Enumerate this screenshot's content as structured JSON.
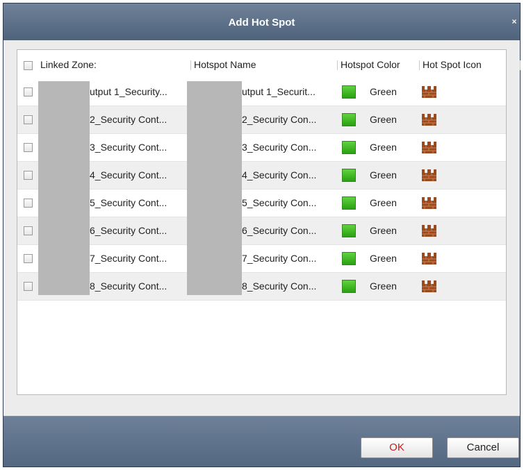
{
  "dialog": {
    "title": "Add Hot Spot",
    "close_glyph": "×"
  },
  "table": {
    "columns": {
      "linked_zone": "Linked Zone:",
      "hotspot_name": "Hotspot Name",
      "hotspot_color": "Hotspot Color",
      "hotspot_icon": "Hot Spot Icon"
    },
    "rows": [
      {
        "linked_zone": "utput 1_Security...",
        "hotspot_name": "utput 1_Securit...",
        "color": "Green",
        "icon": "castle-wall-icon"
      },
      {
        "linked_zone": "2_Security Cont...",
        "hotspot_name": "2_Security Con...",
        "color": "Green",
        "icon": "castle-wall-icon"
      },
      {
        "linked_zone": "3_Security Cont...",
        "hotspot_name": "3_Security Con...",
        "color": "Green",
        "icon": "castle-wall-icon"
      },
      {
        "linked_zone": "4_Security Cont...",
        "hotspot_name": "4_Security Con...",
        "color": "Green",
        "icon": "castle-wall-icon"
      },
      {
        "linked_zone": "5_Security Cont...",
        "hotspot_name": "5_Security Con...",
        "color": "Green",
        "icon": "castle-wall-icon"
      },
      {
        "linked_zone": "6_Security Cont...",
        "hotspot_name": "6_Security Con...",
        "color": "Green",
        "icon": "castle-wall-icon"
      },
      {
        "linked_zone": "7_Security Cont...",
        "hotspot_name": "7_Security Con...",
        "color": "Green",
        "icon": "castle-wall-icon"
      },
      {
        "linked_zone": "8_Security Cont...",
        "hotspot_name": "8_Security Con...",
        "color": "Green",
        "icon": "castle-wall-icon"
      }
    ]
  },
  "colors": {
    "swatch_green": "#3cb923",
    "ok_text": "#c4201c",
    "title_bar": "#5b6e88"
  },
  "buttons": {
    "ok": "OK",
    "cancel": "Cancel"
  }
}
